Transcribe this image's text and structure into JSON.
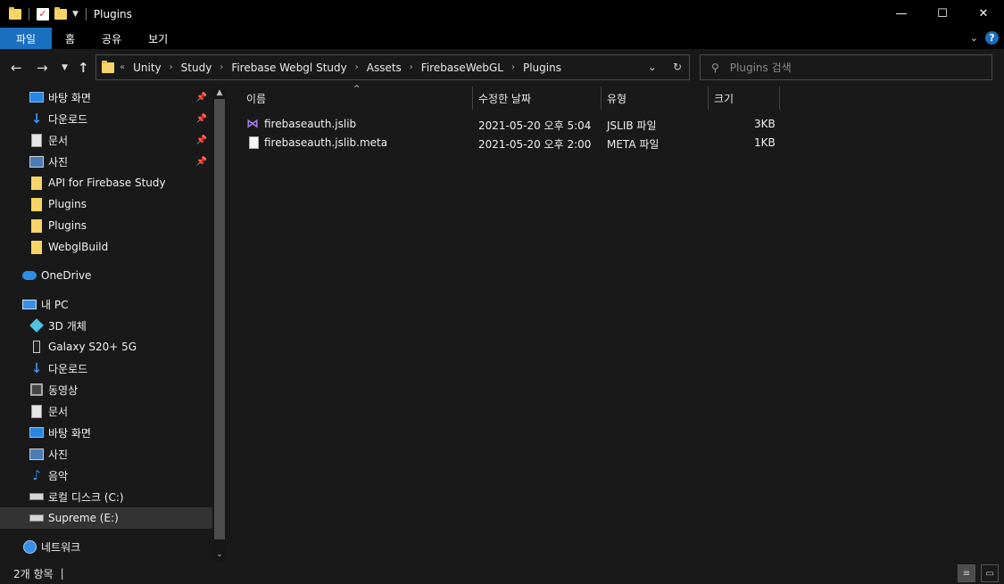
{
  "window": {
    "title": "Plugins",
    "controls": {
      "minimize": "—",
      "maximize": "☐",
      "close": "✕"
    }
  },
  "ribbon": {
    "tabs": [
      "파일",
      "홈",
      "공유",
      "보기"
    ],
    "help": "?"
  },
  "address": {
    "overflow": "«",
    "crumbs": [
      "Unity",
      "Study",
      "Firebase Webgl Study",
      "Assets",
      "FirebaseWebGL",
      "Plugins"
    ]
  },
  "search": {
    "placeholder": "Plugins 검색"
  },
  "sidebar": {
    "quick_access": [
      {
        "label": "바탕 화면",
        "icon": "desktop-icon",
        "pinned": true
      },
      {
        "label": "다운로드",
        "icon": "download-icon",
        "pinned": true
      },
      {
        "label": "문서",
        "icon": "documents-icon",
        "pinned": true
      },
      {
        "label": "사진",
        "icon": "pictures-icon",
        "pinned": true
      },
      {
        "label": "API for Firebase Study",
        "icon": "folder-icon",
        "pinned": false
      },
      {
        "label": "Plugins",
        "icon": "folder-icon",
        "pinned": false
      },
      {
        "label": "Plugins",
        "icon": "folder-icon",
        "pinned": false
      },
      {
        "label": "WebglBuild",
        "icon": "folder-icon",
        "pinned": false
      }
    ],
    "onedrive": "OneDrive",
    "this_pc": "내 PC",
    "pc_items": [
      {
        "label": "3D 개체",
        "icon": "3d-objects-icon"
      },
      {
        "label": "Galaxy S20+ 5G",
        "icon": "phone-icon"
      },
      {
        "label": "다운로드",
        "icon": "download-icon"
      },
      {
        "label": "동영상",
        "icon": "videos-icon"
      },
      {
        "label": "문서",
        "icon": "documents-icon"
      },
      {
        "label": "바탕 화면",
        "icon": "desktop-icon"
      },
      {
        "label": "사진",
        "icon": "pictures-icon"
      },
      {
        "label": "음악",
        "icon": "music-icon"
      },
      {
        "label": "로컬 디스크 (C:)",
        "icon": "drive-icon"
      },
      {
        "label": "Supreme (E:)",
        "icon": "drive-icon"
      }
    ],
    "network": "네트워크"
  },
  "columns": {
    "name": "이름",
    "modified": "수정한 날짜",
    "type": "유형",
    "size": "크기"
  },
  "files": [
    {
      "name": "firebaseauth.jslib",
      "modified": "2021-05-20 오후 5:04",
      "type": "JSLIB 파일",
      "size": "3KB",
      "icon": "visual-studio-icon"
    },
    {
      "name": "firebaseauth.jslib.meta",
      "modified": "2021-05-20 오후 2:00",
      "type": "META 파일",
      "size": "1KB",
      "icon": "file-icon"
    }
  ],
  "status": {
    "count": "2개 항목"
  }
}
